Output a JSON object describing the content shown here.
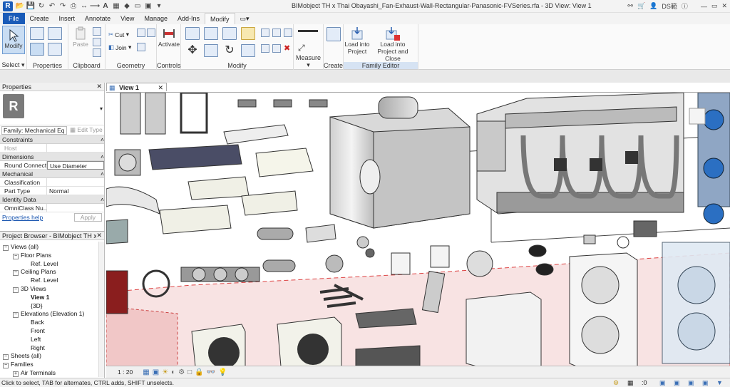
{
  "titlebar": {
    "doc_title": "BIMobject TH x Thai Obayashi_Fan-Exhaust-Wall-Rectangular-Panasonic-FVSeries.rfa - 3D View: View 1",
    "user": "DS範"
  },
  "tabs": [
    "File",
    "Create",
    "Insert",
    "Annotate",
    "View",
    "Manage",
    "Add-Ins",
    "Modify"
  ],
  "active_tab": "Modify",
  "ribbon": {
    "select_panel": {
      "button": "Modify",
      "label": "Select"
    },
    "properties_panel": {
      "label": "Properties"
    },
    "clipboard_panel": {
      "paste": "Paste",
      "label": "Clipboard"
    },
    "geometry_panel": {
      "cut": "Cut",
      "join": "Join",
      "label": "Geometry"
    },
    "controls_panel": {
      "activate": "Activate",
      "label": "Controls"
    },
    "modify_panel": {
      "label": "Modify"
    },
    "measure_panel": {
      "label": "Measure"
    },
    "create_panel": {
      "label": "Create"
    },
    "family_editor_panel": {
      "load_into_project": "Load into\nProject",
      "load_close": "Load into\nProject and Close",
      "label": "Family Editor"
    }
  },
  "properties": {
    "header": "Properties",
    "family_dropdown": "Family: Mechanical Eq",
    "edit_type": "Edit Type",
    "sections": [
      {
        "name": "Constraints",
        "rows": [
          {
            "k": "Host",
            "v": ""
          }
        ]
      },
      {
        "name": "Dimensions",
        "rows": [
          {
            "k": "Round Connect...",
            "v": "Use Diameter"
          }
        ]
      },
      {
        "name": "Mechanical",
        "rows": [
          {
            "k": "Classification",
            "v": ""
          },
          {
            "k": "Part Type",
            "v": "Normal"
          }
        ]
      },
      {
        "name": "Identity Data",
        "rows": [
          {
            "k": "OmniClass Nu...",
            "v": ""
          }
        ]
      }
    ],
    "help_link": "Properties help",
    "apply": "Apply"
  },
  "browser": {
    "header": "Project Browser - BIMobject TH x T",
    "items": [
      {
        "label": "Views (all)",
        "level": 0,
        "toggle": "−"
      },
      {
        "label": "Floor Plans",
        "level": 1,
        "toggle": "−"
      },
      {
        "label": "Ref. Level",
        "level": 2,
        "toggle": ""
      },
      {
        "label": "Ceiling Plans",
        "level": 1,
        "toggle": "−"
      },
      {
        "label": "Ref. Level",
        "level": 2,
        "toggle": ""
      },
      {
        "label": "3D Views",
        "level": 1,
        "toggle": "−"
      },
      {
        "label": "View 1",
        "level": 2,
        "toggle": "",
        "bold": true
      },
      {
        "label": "{3D}",
        "level": 2,
        "toggle": ""
      },
      {
        "label": "Elevations (Elevation 1)",
        "level": 1,
        "toggle": "−"
      },
      {
        "label": "Back",
        "level": 2,
        "toggle": ""
      },
      {
        "label": "Front",
        "level": 2,
        "toggle": ""
      },
      {
        "label": "Left",
        "level": 2,
        "toggle": ""
      },
      {
        "label": "Right",
        "level": 2,
        "toggle": ""
      },
      {
        "label": "Sheets (all)",
        "level": 0,
        "toggle": "−"
      },
      {
        "label": "Families",
        "level": 0,
        "toggle": "−"
      },
      {
        "label": "Air Terminals",
        "level": 1,
        "toggle": "+"
      }
    ]
  },
  "view": {
    "tab_label": "View 1",
    "scale": "1 : 20"
  },
  "status": "Click to select, TAB for alternates, CTRL adds, SHIFT unselects.",
  "status_right": ":0"
}
